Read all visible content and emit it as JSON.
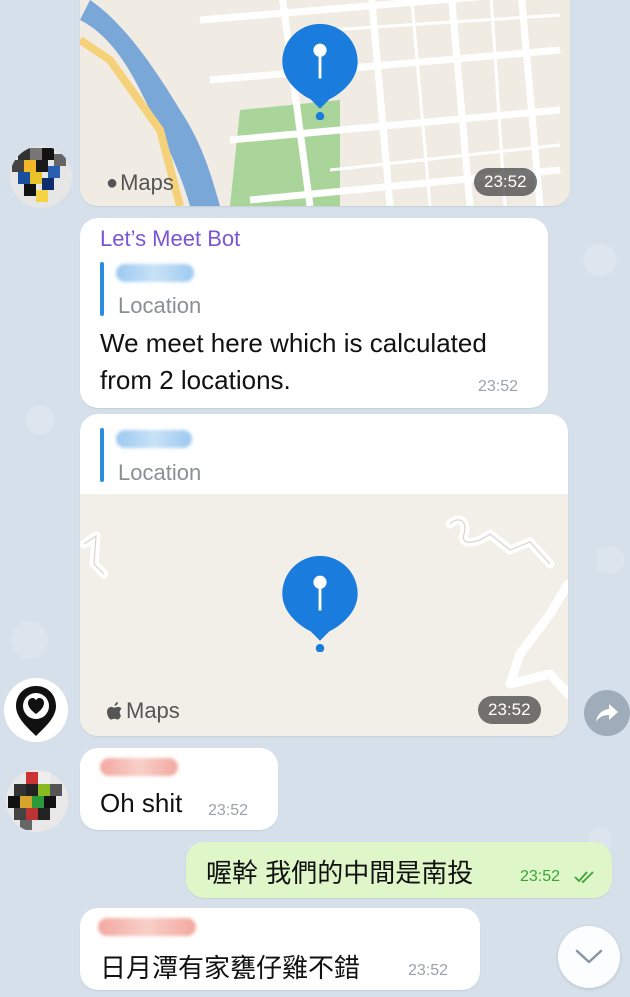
{
  "messages": {
    "top_map": {
      "time": "23:52",
      "maps_label": "Maps"
    },
    "bot_text": {
      "sender": "Let’s Meet Bot",
      "quote_label": "Location",
      "line1": "We meet here which is calculated",
      "line2": "from 2 locations.",
      "time": "23:52"
    },
    "bot_location": {
      "quote_label": "Location",
      "maps_label": "Maps",
      "time": "23:52"
    },
    "oh_shit": {
      "text": "Oh shit",
      "time": "23:52"
    },
    "outgoing": {
      "text": "喔幹 我們的中間是南投",
      "time": "23:52"
    },
    "last": {
      "text": "日月潭有家甕仔雞不錯",
      "time": "23:52"
    }
  },
  "icons": {
    "forward": "share-forward-icon",
    "scroll_down": "chevron-down-icon",
    "read_receipt": "double-check-icon",
    "apple": "apple-logo-icon",
    "pin": "location-pin-icon"
  },
  "colors": {
    "bot_name": "#7b55d4",
    "quote_bar": "#2a8cde",
    "outgoing_bubble": "#dff6c9",
    "outgoing_time": "#3aa33a",
    "pin": "#1a7ddd"
  }
}
